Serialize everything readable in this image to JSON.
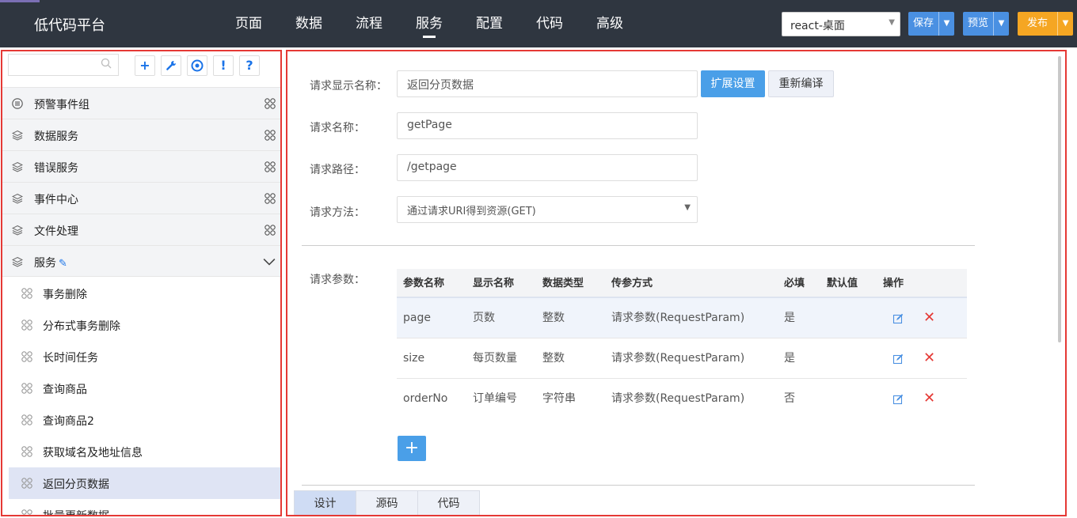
{
  "app": {
    "brand": "低代码平台"
  },
  "nav": [
    {
      "label": "页面"
    },
    {
      "label": "数据"
    },
    {
      "label": "流程"
    },
    {
      "label": "服务",
      "active": true
    },
    {
      "label": "配置"
    },
    {
      "label": "代码"
    },
    {
      "label": "高级"
    }
  ],
  "toolbar": {
    "project": "react-桌面",
    "save_label": "保存",
    "preview_label": "预览",
    "publish_label": "发布"
  },
  "sidebar": {
    "search": {
      "value": "",
      "placeholder": ""
    },
    "tools": [
      "+",
      "wrench-icon",
      "target-icon",
      "!",
      "?"
    ],
    "groups": [
      {
        "label": "预警事件组",
        "icon": "list-icon"
      },
      {
        "label": "数据服务",
        "icon": "layers-icon"
      },
      {
        "label": "错误服务",
        "icon": "layers-icon"
      },
      {
        "label": "事件中心",
        "icon": "layers-icon"
      },
      {
        "label": "文件处理",
        "icon": "layers-icon"
      },
      {
        "label": "服务",
        "icon": "layers-icon",
        "expanded": true
      }
    ],
    "items": [
      {
        "label": "事务删除"
      },
      {
        "label": "分布式事务删除"
      },
      {
        "label": "长时间任务"
      },
      {
        "label": "查询商品"
      },
      {
        "label": "查询商品2"
      },
      {
        "label": "获取域名及地址信息"
      },
      {
        "label": "返回分页数据",
        "selected": true
      },
      {
        "label": "批量更新数据"
      }
    ]
  },
  "form": {
    "display_name_label": "请求显示名称：",
    "display_name_value": "返回分页数据",
    "ext_settings_label": "扩展设置",
    "recompile_label": "重新编译",
    "name_label": "请求名称：",
    "name_value": "getPage",
    "path_label": "请求路径：",
    "path_value": "/getpage",
    "method_label": "请求方法：",
    "method_value": "通过请求URI得到资源(GET)",
    "params_label": "请求参数："
  },
  "params_table": {
    "headers": [
      "参数名称",
      "显示名称",
      "数据类型",
      "传参方式",
      "必填",
      "默认值",
      "操作"
    ],
    "rows": [
      {
        "name": "page",
        "display": "页数",
        "type": "整数",
        "mode": "请求参数(RequestParam)",
        "required": "是",
        "default": ""
      },
      {
        "name": "size",
        "display": "每页数量",
        "type": "整数",
        "mode": "请求参数(RequestParam)",
        "required": "是",
        "default": ""
      },
      {
        "name": "orderNo",
        "display": "订单编号",
        "type": "字符串",
        "mode": "请求参数(RequestParam)",
        "required": "否",
        "default": ""
      }
    ]
  },
  "add_label": "+",
  "bottom_tabs": [
    {
      "label": "设计",
      "active": true
    },
    {
      "label": "源码"
    },
    {
      "label": "代码"
    }
  ],
  "colors": {
    "accent": "#4a90e2",
    "publish": "#f5a623",
    "highlight": "#e53935",
    "topbar": "#2f3640"
  }
}
